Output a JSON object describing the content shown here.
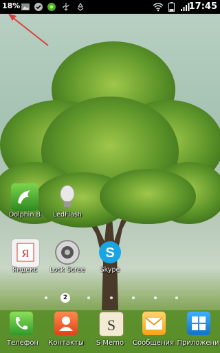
{
  "status_bar": {
    "battery_percent": "18%",
    "time": "17:45",
    "icons": [
      "image-notification-icon",
      "sync-check-icon",
      "green-app-icon",
      "usb-icon",
      "recycle-icon",
      "wifi-icon",
      "battery-icon"
    ]
  },
  "home": {
    "apps": [
      {
        "label": "Dolphin B",
        "icon": "dolphin-browser-icon"
      },
      {
        "label": "LedFlash",
        "icon": "lightbulb-icon"
      },
      {
        "label": "Яндекс",
        "icon": "yandex-icon"
      },
      {
        "label": "Lock Scree",
        "icon": "lock-screen-icon"
      },
      {
        "label": "Skype",
        "icon": "skype-icon"
      }
    ],
    "current_page": "2"
  },
  "dock": {
    "items": [
      {
        "label": "Телефон",
        "icon": "phone-icon"
      },
      {
        "label": "Контакты",
        "icon": "contacts-icon"
      },
      {
        "label": "S Memo",
        "icon": "s-memo-icon"
      },
      {
        "label": "Сообщения",
        "icon": "messages-icon"
      },
      {
        "label": "Приложени",
        "icon": "apps-grid-icon"
      }
    ]
  },
  "colors": {
    "status_bar": "#000000",
    "annotation_arrow": "#d9413a"
  }
}
